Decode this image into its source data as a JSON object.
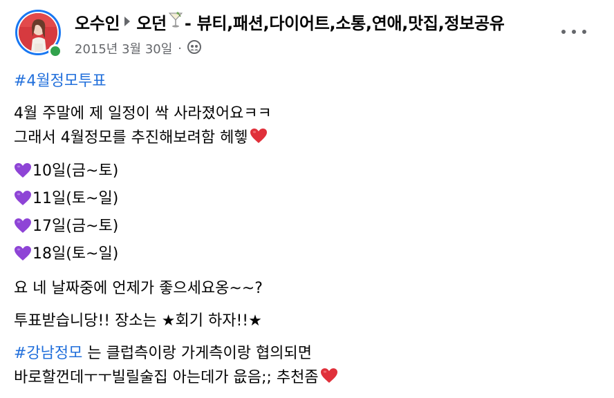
{
  "post": {
    "author": "오수인",
    "group": "오던",
    "group_suffix": "- 뷰티,패션,다이어트,소통,연애,맛집,정보공유",
    "date": "2015년 3월 30일",
    "separator": "·"
  },
  "content": {
    "hashtag_vote": "#4월정모투표",
    "line1": "4월 주말에 제 일정이 싹 사라졌어요ㅋㅋ",
    "line2": "그래서 4월정모를 추진해보려함 헤헿",
    "dates": [
      "10일(금~토)",
      "11일(토~일)",
      "17일(금~토)",
      "18일(토~일)"
    ],
    "question": "요 네 날짜중에 언제가 좋으세요옹~~?",
    "vote_line": "투표받습니당!! 장소는 ★회기 하자!!★",
    "hashtag_gangnam": "#강남정모",
    "gangnam_text": " 는 클럽측이랑 가게측이랑 협의되면",
    "last_line": "바로할껀데ㅜㅜ빌릴술집 아는데가 읎음;; 추천좀"
  },
  "icons": {
    "audience": "friends-audience-icon",
    "more": "more-options-icon",
    "heart": "red-heart-emoji",
    "purple_heart": "purple-heart-emoji"
  },
  "colors": {
    "accent": "#1877f2",
    "hashtag": "#216fdb",
    "online": "#31a24c",
    "secondary_text": "#65676b"
  }
}
